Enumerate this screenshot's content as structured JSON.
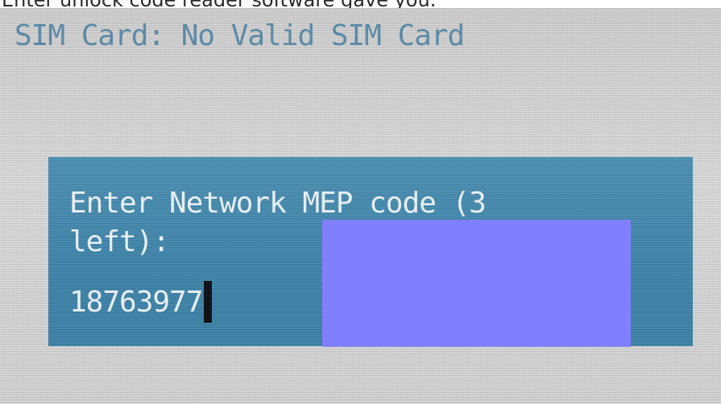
{
  "caption": "Enter unlock code reader software gave you.",
  "phone_screen": {
    "status_line": "SIM Card: No Valid SIM Card",
    "dialog": {
      "prompt_line_1": "Enter Network MEP code (3",
      "prompt_line_2": "left):",
      "code_value": "18763977"
    }
  },
  "colors": {
    "dialog_background": "#3f86ac",
    "status_text": "#5c8aa6",
    "redaction": "#8080ff"
  }
}
